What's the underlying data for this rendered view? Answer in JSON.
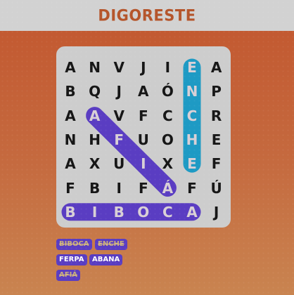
{
  "app": {
    "title": "DIGORESTE"
  },
  "grid": {
    "rows": [
      [
        "A",
        "N",
        "V",
        "J",
        "I",
        "E",
        "A"
      ],
      [
        "B",
        "Q",
        "J",
        "A",
        "Ó",
        "N",
        "P"
      ],
      [
        "A",
        "A",
        "V",
        "F",
        "C",
        "C",
        "R"
      ],
      [
        "N",
        "H",
        "F",
        "U",
        "O",
        "H",
        "E"
      ],
      [
        "A",
        "X",
        "U",
        "I",
        "X",
        "E",
        "F"
      ],
      [
        "F",
        "B",
        "I",
        "F",
        "Á",
        "F",
        "Ú"
      ],
      [
        "B",
        "I",
        "B",
        "O",
        "C",
        "A",
        "J"
      ]
    ]
  },
  "highlights": [
    {
      "word": "ENCHE",
      "color": "#1e9ac4",
      "from": [
        0,
        5
      ],
      "to": [
        4,
        5
      ]
    },
    {
      "word": "AFIÁ",
      "color": "#5a3dc2",
      "from": [
        2,
        1
      ],
      "to": [
        5,
        4
      ]
    },
    {
      "word": "BIBOCA",
      "color": "#5a3dc2",
      "from": [
        6,
        0
      ],
      "to": [
        6,
        5
      ]
    }
  ],
  "word_list": [
    {
      "label": "BIBOCA",
      "found": true
    },
    {
      "label": "ENCHE",
      "found": true
    },
    {
      "label": "FERPA",
      "found": false
    },
    {
      "label": "ABANA",
      "found": false
    },
    {
      "label": "AFIÁ",
      "found": true
    }
  ],
  "colors": {
    "accent": "#b5552b",
    "word_chip": "#5a3dc2",
    "highlight_cyan": "#1e9ac4"
  }
}
